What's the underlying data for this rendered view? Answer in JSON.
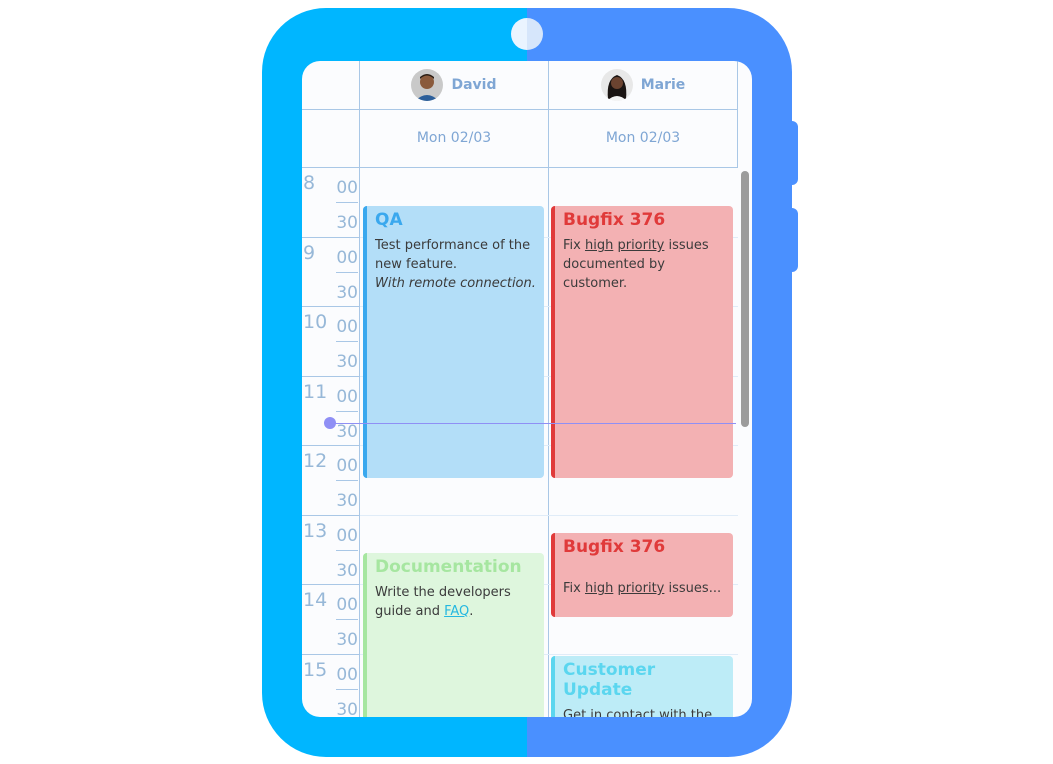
{
  "resources": [
    {
      "name": "David",
      "date": "Mon 02/03"
    },
    {
      "name": "Marie",
      "date": "Mon 02/03"
    }
  ],
  "time_slots": {
    "hours": [
      "8",
      "9",
      "10",
      "11",
      "12",
      "13",
      "14",
      "15"
    ],
    "minutes": [
      "00",
      "30"
    ]
  },
  "current_time": "11:30",
  "appointments": {
    "qa": {
      "title": "QA",
      "desc_line1": "Test performance of the new feature.",
      "desc_line2": "With remote connection.",
      "start": "8:30",
      "end": "12:30",
      "resource": "David",
      "color": "#3aa8ee",
      "bg": "#b3def8"
    },
    "bugfix1": {
      "title": "Bugfix 376",
      "desc_pre": "Fix ",
      "desc_u1": "high",
      "desc_u2": "priority",
      "desc_post": " issues documented by customer.",
      "start": "8:30",
      "end": "12:30",
      "resource": "Marie",
      "color": "#e03a3a",
      "bg": "#f3b1b3"
    },
    "documentation": {
      "title": "Documentation",
      "desc_pre": "Write the developers guide and ",
      "desc_link": "FAQ",
      "desc_post": ".",
      "start": "13:30",
      "end": "16:00",
      "resource": "David",
      "color": "#a6e6a0",
      "bg": "#def6dd"
    },
    "bugfix2": {
      "title": "Bugfix 376",
      "desc_pre": "Fix ",
      "desc_u1": "high",
      "desc_u2": "priority",
      "desc_post": " issues...",
      "start": "13:15",
      "end": "14:30",
      "resource": "Marie",
      "color": "#e03a3a",
      "bg": "#f3b1b3"
    },
    "customer_update": {
      "title": "Customer Update",
      "desc": "Get in contact with the customer to let them know",
      "start": "15:00",
      "end": "16:00",
      "resource": "Marie",
      "color": "#5bd6ef",
      "bg": "#bdecf7"
    }
  },
  "device_colors": {
    "left": "#00b6ff",
    "right": "#4a90ff"
  }
}
